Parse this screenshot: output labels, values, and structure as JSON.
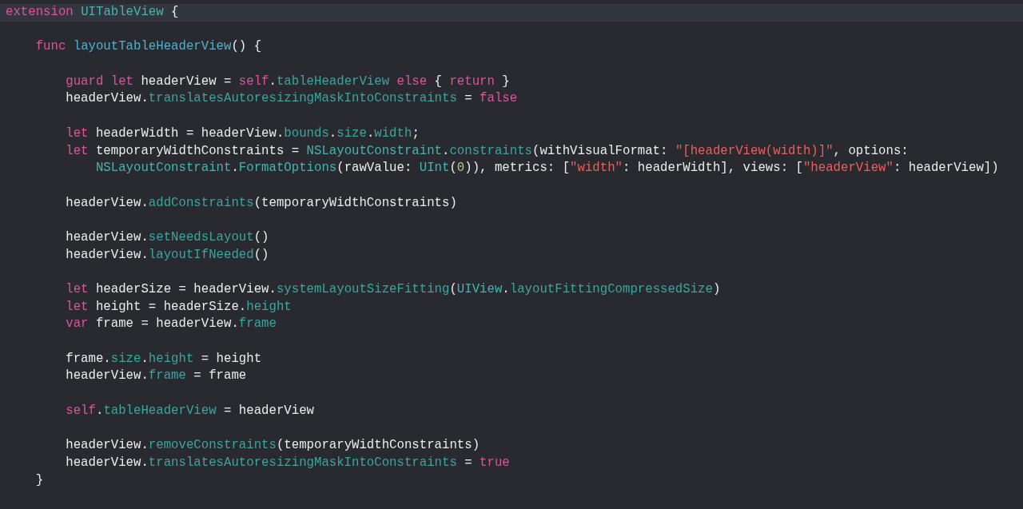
{
  "lines": [
    {
      "current": true,
      "tokens": [
        {
          "kind": "keyword",
          "text": "extension "
        },
        {
          "kind": "type",
          "text": "UITableView"
        },
        {
          "kind": "plain",
          "text": " {"
        }
      ]
    },
    {
      "current": false
    },
    {
      "current": false,
      "tokens": [
        {
          "kind": "keyword",
          "text": "    func "
        },
        {
          "kind": "decl",
          "text": "layoutTableHeaderView"
        },
        {
          "kind": "plain",
          "text": "() {"
        }
      ]
    },
    {
      "current": false
    },
    {
      "current": false,
      "tokens": [
        {
          "kind": "keyword",
          "text": "        guard let"
        },
        {
          "kind": "plain",
          "text": " headerView = "
        },
        {
          "kind": "keyword",
          "text": "self"
        },
        {
          "kind": "plain",
          "text": "."
        },
        {
          "kind": "member",
          "text": "tableHeaderView"
        },
        {
          "kind": "keyword",
          "text": " else"
        },
        {
          "kind": "plain",
          "text": " { "
        },
        {
          "kind": "keyword",
          "text": "return"
        },
        {
          "kind": "plain",
          "text": " }"
        }
      ]
    },
    {
      "current": false,
      "tokens": [
        {
          "kind": "plain",
          "text": "        headerView."
        },
        {
          "kind": "member",
          "text": "translatesAutoresizingMaskIntoConstraints"
        },
        {
          "kind": "plain",
          "text": " = "
        },
        {
          "kind": "keyword",
          "text": "false"
        }
      ]
    },
    {
      "current": false
    },
    {
      "current": false,
      "tokens": [
        {
          "kind": "keyword",
          "text": "        let"
        },
        {
          "kind": "plain",
          "text": " headerWidth = headerView."
        },
        {
          "kind": "member",
          "text": "bounds"
        },
        {
          "kind": "plain",
          "text": "."
        },
        {
          "kind": "member",
          "text": "size"
        },
        {
          "kind": "plain",
          "text": "."
        },
        {
          "kind": "member",
          "text": "width"
        },
        {
          "kind": "plain",
          "text": ";"
        }
      ]
    },
    {
      "current": false,
      "tokens": [
        {
          "kind": "keyword",
          "text": "        let"
        },
        {
          "kind": "plain",
          "text": " temporaryWidthConstraints = "
        },
        {
          "kind": "type",
          "text": "NSLayoutConstraint"
        },
        {
          "kind": "plain",
          "text": "."
        },
        {
          "kind": "member",
          "text": "constraints"
        },
        {
          "kind": "plain",
          "text": "(withVisualFormat: "
        },
        {
          "kind": "string",
          "text": "\"[headerView(width)]\""
        },
        {
          "kind": "plain",
          "text": ", options:"
        }
      ]
    },
    {
      "current": false,
      "tokens": [
        {
          "kind": "type",
          "text": "            NSLayoutConstraint"
        },
        {
          "kind": "plain",
          "text": "."
        },
        {
          "kind": "type",
          "text": "FormatOptions"
        },
        {
          "kind": "plain",
          "text": "(rawValue: "
        },
        {
          "kind": "type",
          "text": "UInt"
        },
        {
          "kind": "plain",
          "text": "("
        },
        {
          "kind": "number",
          "text": "0"
        },
        {
          "kind": "plain",
          "text": ")), metrics: ["
        },
        {
          "kind": "string",
          "text": "\"width\""
        },
        {
          "kind": "plain",
          "text": ": headerWidth], views: ["
        },
        {
          "kind": "string",
          "text": "\"headerView\""
        },
        {
          "kind": "plain",
          "text": ": headerView])"
        }
      ]
    },
    {
      "current": false
    },
    {
      "current": false,
      "tokens": [
        {
          "kind": "plain",
          "text": "        headerView."
        },
        {
          "kind": "member",
          "text": "addConstraints"
        },
        {
          "kind": "plain",
          "text": "(temporaryWidthConstraints)"
        }
      ]
    },
    {
      "current": false
    },
    {
      "current": false,
      "tokens": [
        {
          "kind": "plain",
          "text": "        headerView."
        },
        {
          "kind": "member",
          "text": "setNeedsLayout"
        },
        {
          "kind": "plain",
          "text": "()"
        }
      ]
    },
    {
      "current": false,
      "tokens": [
        {
          "kind": "plain",
          "text": "        headerView."
        },
        {
          "kind": "member",
          "text": "layoutIfNeeded"
        },
        {
          "kind": "plain",
          "text": "()"
        }
      ]
    },
    {
      "current": false
    },
    {
      "current": false,
      "tokens": [
        {
          "kind": "keyword",
          "text": "        let"
        },
        {
          "kind": "plain",
          "text": " headerSize = headerView."
        },
        {
          "kind": "member",
          "text": "systemLayoutSizeFitting"
        },
        {
          "kind": "plain",
          "text": "("
        },
        {
          "kind": "type",
          "text": "UIView"
        },
        {
          "kind": "plain",
          "text": "."
        },
        {
          "kind": "member",
          "text": "layoutFittingCompressedSize"
        },
        {
          "kind": "plain",
          "text": ")"
        }
      ]
    },
    {
      "current": false,
      "tokens": [
        {
          "kind": "keyword",
          "text": "        let"
        },
        {
          "kind": "plain",
          "text": " height = headerSize."
        },
        {
          "kind": "member",
          "text": "height"
        }
      ]
    },
    {
      "current": false,
      "tokens": [
        {
          "kind": "keyword",
          "text": "        var"
        },
        {
          "kind": "plain",
          "text": " frame = headerView."
        },
        {
          "kind": "member",
          "text": "frame"
        }
      ]
    },
    {
      "current": false
    },
    {
      "current": false,
      "tokens": [
        {
          "kind": "plain",
          "text": "        frame."
        },
        {
          "kind": "member",
          "text": "size"
        },
        {
          "kind": "plain",
          "text": "."
        },
        {
          "kind": "member",
          "text": "height"
        },
        {
          "kind": "plain",
          "text": " = height"
        }
      ]
    },
    {
      "current": false,
      "tokens": [
        {
          "kind": "plain",
          "text": "        headerView."
        },
        {
          "kind": "member",
          "text": "frame"
        },
        {
          "kind": "plain",
          "text": " = frame"
        }
      ]
    },
    {
      "current": false
    },
    {
      "current": false,
      "tokens": [
        {
          "kind": "keyword",
          "text": "        self"
        },
        {
          "kind": "plain",
          "text": "."
        },
        {
          "kind": "member",
          "text": "tableHeaderView"
        },
        {
          "kind": "plain",
          "text": " = headerView"
        }
      ]
    },
    {
      "current": false
    },
    {
      "current": false,
      "tokens": [
        {
          "kind": "plain",
          "text": "        headerView."
        },
        {
          "kind": "member",
          "text": "removeConstraints"
        },
        {
          "kind": "plain",
          "text": "(temporaryWidthConstraints)"
        }
      ]
    },
    {
      "current": false,
      "tokens": [
        {
          "kind": "plain",
          "text": "        headerView."
        },
        {
          "kind": "member",
          "text": "translatesAutoresizingMaskIntoConstraints"
        },
        {
          "kind": "plain",
          "text": " = "
        },
        {
          "kind": "keyword",
          "text": "true"
        }
      ]
    },
    {
      "current": false,
      "tokens": [
        {
          "kind": "plain",
          "text": "    }"
        }
      ]
    }
  ]
}
